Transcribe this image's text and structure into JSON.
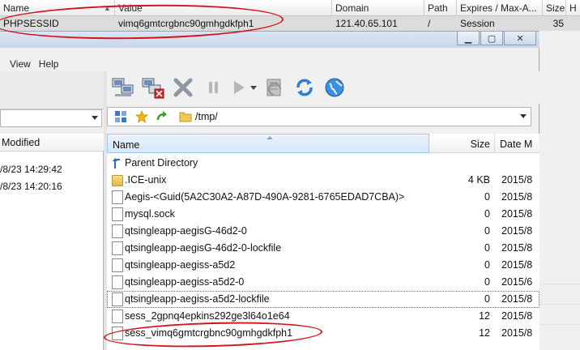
{
  "cookie_table": {
    "columns": [
      "Name",
      "Value",
      "Domain",
      "Path",
      "Expires / Max-A...",
      "Size",
      "H"
    ],
    "row": {
      "name": "PHPSESSID",
      "value": "vimq6gmtcrgbnc90gmhgdkfph1",
      "domain": "121.40.65.101",
      "path": "/",
      "expires": "Session",
      "size": "35"
    }
  },
  "window": {
    "buttons": {
      "minimize": "▁",
      "maximize": "▢",
      "close": "✕"
    },
    "menu": [
      "View",
      "Help"
    ]
  },
  "left_pane": {
    "header": "Modified",
    "rows": [
      "/8/23 14:29:42",
      "/8/23 14:20:16"
    ]
  },
  "toolbar_icons": [
    "network-connect-icon",
    "network-disconnect-icon",
    "delete-icon",
    "pause-icon",
    "play-icon",
    "play-dropdown-icon",
    "queue-icon",
    "refresh-icon",
    "globe-icon"
  ],
  "address": {
    "path": "/tmp/"
  },
  "file_list": {
    "columns": {
      "name": "Name",
      "size": "Size",
      "date": "Date M"
    },
    "rows": [
      {
        "name": "Parent Directory",
        "size": "",
        "date": "",
        "type": "parent"
      },
      {
        "name": ".ICE-unix",
        "size": "4 KB",
        "date": "2015/8",
        "type": "folder"
      },
      {
        "name": "Aegis-<Guid(5A2C30A2-A87D-490A-9281-6765EDAD7CBA)>",
        "size": "0",
        "date": "2015/8",
        "type": "file"
      },
      {
        "name": "mysql.sock",
        "size": "0",
        "date": "2015/8",
        "type": "file"
      },
      {
        "name": "qtsingleapp-aegisG-46d2-0",
        "size": "0",
        "date": "2015/8",
        "type": "file"
      },
      {
        "name": "qtsingleapp-aegisG-46d2-0-lockfile",
        "size": "0",
        "date": "2015/8",
        "type": "file"
      },
      {
        "name": "qtsingleapp-aegiss-a5d2",
        "size": "0",
        "date": "2015/8",
        "type": "file"
      },
      {
        "name": "qtsingleapp-aegiss-a5d2-0",
        "size": "0",
        "date": "2015/6",
        "type": "file"
      },
      {
        "name": "qtsingleapp-aegiss-a5d2-lockfile",
        "size": "0",
        "date": "2015/8",
        "type": "file",
        "selected": true
      },
      {
        "name": "sess_2gpnq4epkins292ge3l64o1e64",
        "size": "12",
        "date": "2015/8",
        "type": "file"
      },
      {
        "name": "sess_vimq6gmtcrgbnc90gmhgdkfph1",
        "size": "12",
        "date": "2015/8",
        "type": "file"
      }
    ]
  },
  "colors": {
    "highlight_ellipse": "#d4141c",
    "header_selected": "#d6e8fa"
  }
}
